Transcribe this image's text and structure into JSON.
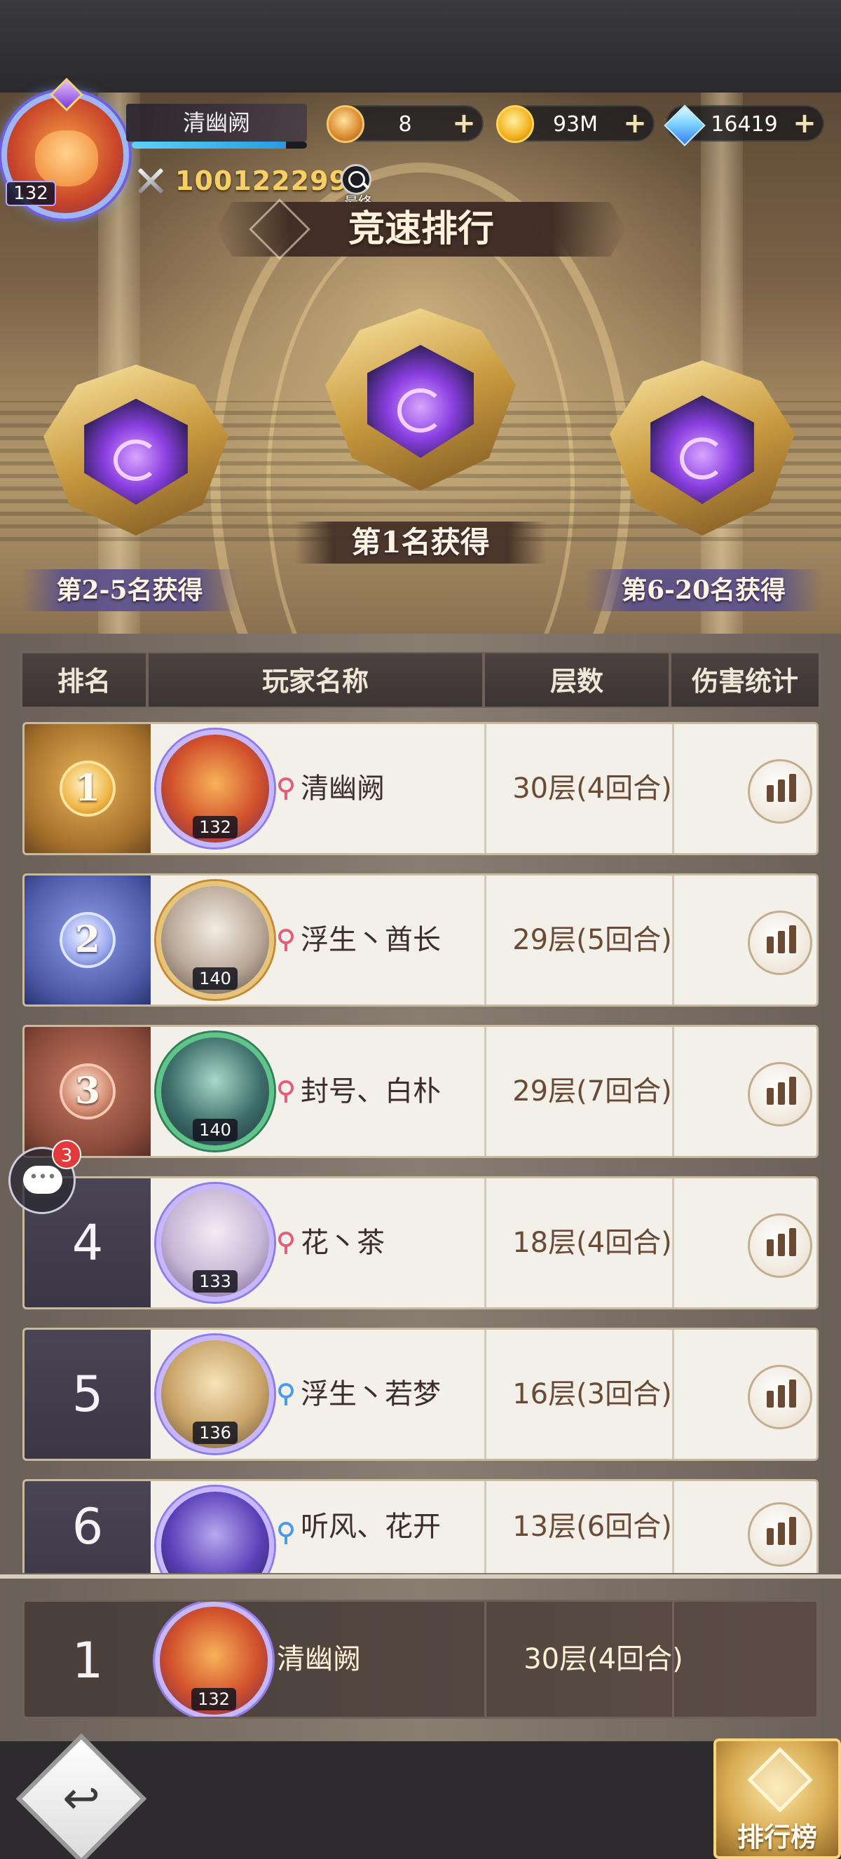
{
  "player": {
    "name": "清幽阙",
    "level": "132",
    "power": "100122299",
    "final_label": "最终",
    "xp_fraction": 0.88
  },
  "resources": [
    {
      "icon": "token-icon",
      "value": "8"
    },
    {
      "icon": "gold-coin-icon",
      "value": "93M"
    },
    {
      "icon": "diamond-icon",
      "value": "16419"
    }
  ],
  "page": {
    "title": "竞速排行"
  },
  "rewards": {
    "first": "第1名获得",
    "second_to_fifth": "第2-5名获得",
    "sixth_to_twentieth": "第6-20名获得"
  },
  "table": {
    "headers": [
      "排名",
      "玩家名称",
      "层数",
      "伤害统计"
    ],
    "rows": [
      {
        "rank": "1",
        "name": "清幽阙",
        "level": "132",
        "gender": "female",
        "floors": "30层(4回合)"
      },
      {
        "rank": "2",
        "name": "浮生丶酋长",
        "level": "140",
        "gender": "female",
        "floors": "29层(5回合)"
      },
      {
        "rank": "3",
        "name": "封号、白朴",
        "level": "140",
        "gender": "female",
        "floors": "29层(7回合)"
      },
      {
        "rank": "4",
        "name": "花丶茶",
        "level": "133",
        "gender": "female",
        "floors": "18层(4回合)"
      },
      {
        "rank": "5",
        "name": "浮生丶若梦",
        "level": "136",
        "gender": "male",
        "floors": "16层(3回合)"
      },
      {
        "rank": "6",
        "name": "听风、花开",
        "level": "",
        "gender": "male",
        "floors": "13层(6回合)"
      }
    ]
  },
  "my_rank": {
    "rank": "1",
    "name": "清幽阙",
    "level": "132",
    "floors": "30层(4回合)"
  },
  "chat": {
    "unread": "3"
  },
  "footer": {
    "back_glyph": "↩",
    "leaderboard_label": "排行榜"
  },
  "colors": {
    "gold_rank": "#a5702c",
    "silver_rank": "#4c5aa8",
    "bronze_rank": "#8a4a3a",
    "power_text": "#f7cf64",
    "female": "#e0607a",
    "male": "#4a9be6"
  }
}
